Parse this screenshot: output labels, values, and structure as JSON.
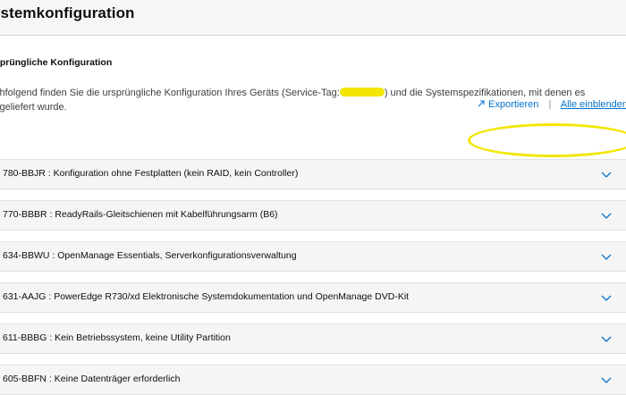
{
  "header": {
    "title": "ystemkonfiguration"
  },
  "section": {
    "title": "sprüngliche Konfiguration",
    "description_before": "chfolgend finden Sie die ursprüngliche Konfiguration Ihres Geräts (Service-Tag:",
    "description_after": ") und die Systemspezifikationen, mit denen es",
    "description_line2": "sgeliefert wurde."
  },
  "actions": {
    "export_label": "Exportieren",
    "show_all_label": "Alle einblenden",
    "export_icon": "external-link-icon"
  },
  "colors": {
    "link": "#0672cb",
    "highlight": "#f3e600",
    "chevron": "#0672cb"
  },
  "items": [
    {
      "label": "780-BBJR : Konfiguration ohne Festplatten (kein RAID, kein Controller)"
    },
    {
      "label": "770-BBBR : ReadyRails-Gleitschienen mit Kabelführungsarm (B6)"
    },
    {
      "label": "634-BBWU : OpenManage Essentials, Serverkonfigurationsverwaltung"
    },
    {
      "label": "631-AAJG : PowerEdge R730/xd Elektronische Systemdokumentation und OpenManage DVD-Kit"
    },
    {
      "label": "611-BBBG : Kein Betriebssystem, keine Utility Partition"
    },
    {
      "label": "605-BBFN : Keine Datenträger erforderlich"
    }
  ]
}
